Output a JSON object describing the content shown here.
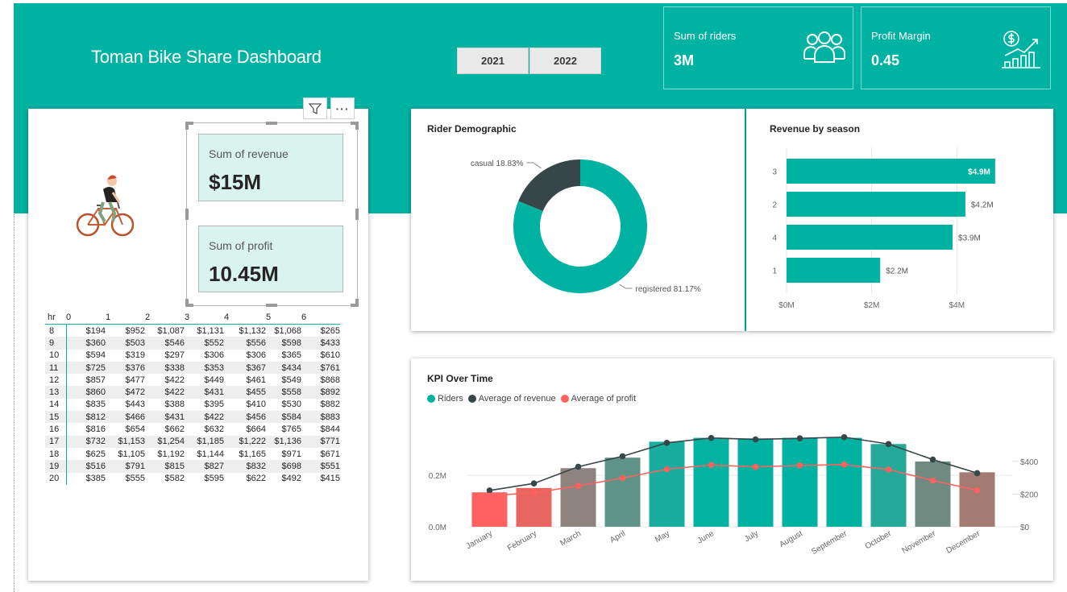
{
  "header": {
    "title": "Toman Bike Share Dashboard",
    "year_buttons": [
      "2021",
      "2022"
    ],
    "kpis": [
      {
        "label": "Sum of riders",
        "value": "3M",
        "icon": "people-group-icon"
      },
      {
        "label": "Profit Margin",
        "value": "0.45",
        "icon": "money-growth-chart-icon"
      }
    ]
  },
  "left_panel": {
    "cards": [
      {
        "label": "Sum of revenue",
        "value": "$15M"
      },
      {
        "label": "Sum of profit",
        "value": "10.45M"
      }
    ],
    "image_icon": "cyclist-illustration-icon",
    "toolbar_icons": [
      "filter-icon",
      "more-options-icon"
    ],
    "toolbar_more_text": "···",
    "table": {
      "corner": "hr",
      "columns": [
        "0",
        "1",
        "2",
        "3",
        "4",
        "5",
        "6"
      ],
      "rows": [
        {
          "hr": "8",
          "values": [
            "$194",
            "$952",
            "$1,087",
            "$1,131",
            "$1,132",
            "$1,068",
            "$265"
          ]
        },
        {
          "hr": "9",
          "values": [
            "$360",
            "$503",
            "$546",
            "$552",
            "$556",
            "$598",
            "$433"
          ]
        },
        {
          "hr": "10",
          "values": [
            "$594",
            "$319",
            "$297",
            "$306",
            "$306",
            "$365",
            "$610"
          ]
        },
        {
          "hr": "11",
          "values": [
            "$725",
            "$376",
            "$338",
            "$353",
            "$367",
            "$434",
            "$761"
          ]
        },
        {
          "hr": "12",
          "values": [
            "$857",
            "$477",
            "$422",
            "$449",
            "$461",
            "$549",
            "$868"
          ]
        },
        {
          "hr": "13",
          "values": [
            "$860",
            "$472",
            "$422",
            "$431",
            "$455",
            "$558",
            "$892"
          ]
        },
        {
          "hr": "14",
          "values": [
            "$835",
            "$443",
            "$388",
            "$395",
            "$410",
            "$530",
            "$882"
          ]
        },
        {
          "hr": "15",
          "values": [
            "$812",
            "$466",
            "$431",
            "$422",
            "$456",
            "$584",
            "$883"
          ]
        },
        {
          "hr": "16",
          "values": [
            "$816",
            "$654",
            "$662",
            "$632",
            "$664",
            "$765",
            "$844"
          ]
        },
        {
          "hr": "17",
          "values": [
            "$732",
            "$1,153",
            "$1,254",
            "$1,185",
            "$1,222",
            "$1,136",
            "$771"
          ]
        },
        {
          "hr": "18",
          "values": [
            "$625",
            "$1,105",
            "$1,192",
            "$1,144",
            "$1,165",
            "$971",
            "$671"
          ]
        },
        {
          "hr": "19",
          "values": [
            "$516",
            "$791",
            "$815",
            "$827",
            "$832",
            "$698",
            "$551"
          ]
        },
        {
          "hr": "20",
          "values": [
            "$385",
            "$555",
            "$582",
            "$595",
            "$622",
            "$492",
            "$415"
          ]
        }
      ]
    }
  },
  "chart_data": [
    {
      "type": "pie",
      "variant": "donut",
      "title": "Rider Demographic",
      "slices": [
        {
          "label": "casual 18.83%",
          "value": 18.83,
          "color": "#374649"
        },
        {
          "label": "registered 81.17%",
          "value": 81.17,
          "color": "#00b2a2"
        }
      ]
    },
    {
      "type": "bar",
      "orientation": "horizontal",
      "title": "Revenue by season",
      "categories": [
        "3",
        "2",
        "4",
        "1"
      ],
      "values": [
        4.9,
        4.2,
        3.9,
        2.2
      ],
      "data_labels": [
        "$4.9M",
        "$4.2M",
        "$3.9M",
        "$2.2M"
      ],
      "x_ticks": [
        "$0M",
        "$2M",
        "$4M"
      ],
      "xlim": [
        0,
        5.3
      ],
      "color": "#00b2a2"
    },
    {
      "type": "bar",
      "combo": "bar-line",
      "title": "KPI Over Time",
      "legend": [
        "Riders",
        "Average of revenue",
        "Average of profit"
      ],
      "legend_colors": [
        "#00b2a2",
        "#374649",
        "#fd625e"
      ],
      "categories": [
        "January",
        "February",
        "March",
        "April",
        "May",
        "June",
        "July",
        "August",
        "September",
        "October",
        "November",
        "December"
      ],
      "series": [
        {
          "name": "Riders",
          "axis": "left",
          "values": [
            0.134,
            0.151,
            0.228,
            0.269,
            0.331,
            0.346,
            0.344,
            0.346,
            0.346,
            0.322,
            0.254,
            0.212
          ],
          "colors": [
            "#fd625e",
            "#e86661",
            "#8f8380",
            "#5e9488",
            "#18ad9e",
            "#05b1a1",
            "#00b2a2",
            "#00b2a2",
            "#00b2a2",
            "#25a99b",
            "#6e8a81",
            "#a27b73"
          ]
        },
        {
          "name": "Average of revenue",
          "axis": "right",
          "values": [
            222,
            265,
            367,
            431,
            513,
            543,
            534,
            541,
            548,
            506,
            411,
            328
          ]
        },
        {
          "name": "Average of profit",
          "axis": "right",
          "values": [
            190,
            208,
            250,
            298,
            352,
            378,
            366,
            375,
            380,
            350,
            283,
            223
          ]
        }
      ],
      "y_left_ticks": [
        "0.0M",
        "0.2M"
      ],
      "y_left_range": [
        0,
        0.42
      ],
      "y_right_ticks": [
        "$0",
        "$200",
        "$400"
      ],
      "y_right_range": [
        0,
        660
      ]
    }
  ]
}
